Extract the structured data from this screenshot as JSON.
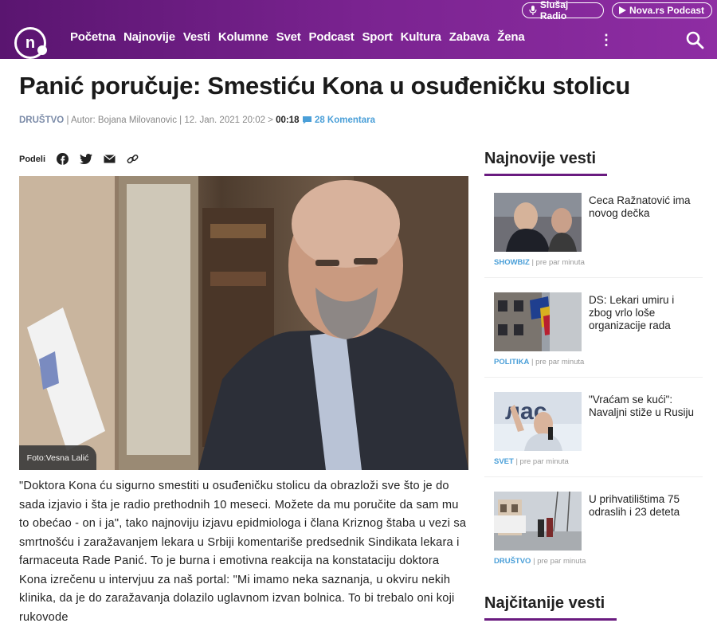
{
  "header": {
    "logo_letter": "n",
    "nav": [
      "Početna",
      "Najnovije",
      "Vesti",
      "Kolumne",
      "Svet",
      "Podcast",
      "Sport",
      "Kultura",
      "Zabava",
      "Žena"
    ],
    "more_icon": "kebab-menu-icon",
    "radio_label": "Slušaj Radio",
    "podcast_label": "Nova.rs Podcast"
  },
  "article": {
    "title": "Panić poručuje: Smestiću Kona u osuđeničku stolicu",
    "category": "DRUŠTVO",
    "author": "| Autor: Bojana Milovanovic | 12. Jan. 2021 20:02 > ",
    "duration": "00:18",
    "comments": "28 Komentara",
    "share_label": "Podeli",
    "photo_caption": "Foto:Vesna Lalić",
    "body": "\"Doktora Kona ću sigurno smestiti u osuđeničku stolicu da obrazloži sve što je do sada izjavio i šta je radio prethodnih 10 meseci. Možete da mu poručite da sam mu to obećao - on i ja\", tako najnoviju izjavu epidmiologa i člana Kriznog štaba u vezi sa smrtnošću i zaražavanjem lekara u Srbiji komentariše predsednik Sindikata lekara i farmaceuta Rade Panić. To je burna i emotivna reakcija na konstataciju doktora Kona izrečenu u intervjuu za naš portal: \"Mi imamo neka saznanja, u okviru nekih klinika, da je do zaražavanja dolazilo uglavnom izvan bolnica. To bi trebalo oni koji rukovode"
  },
  "sidebar": {
    "latest_heading": "Najnovije vesti",
    "most_read_heading": "Najčitanije vesti",
    "items": [
      {
        "title": "Ceca Ražnatović ima novog dečka",
        "category": "SHOWBIZ",
        "time": " | pre par minuta"
      },
      {
        "title": "DS: Lekari umiru i zbog vrlo loše organizacije rada",
        "category": "POLITIKA",
        "time": " | pre par minuta"
      },
      {
        "title": "\"Vraćam se kući\": Navaljni stiže u Rusiju",
        "category": "SVET",
        "time": " | pre par minuta"
      },
      {
        "title": "U prihvatilištima 75 odraslih i 23 deteta",
        "category": "DRUŠTVO",
        "time": " | pre par minuta"
      }
    ]
  }
}
